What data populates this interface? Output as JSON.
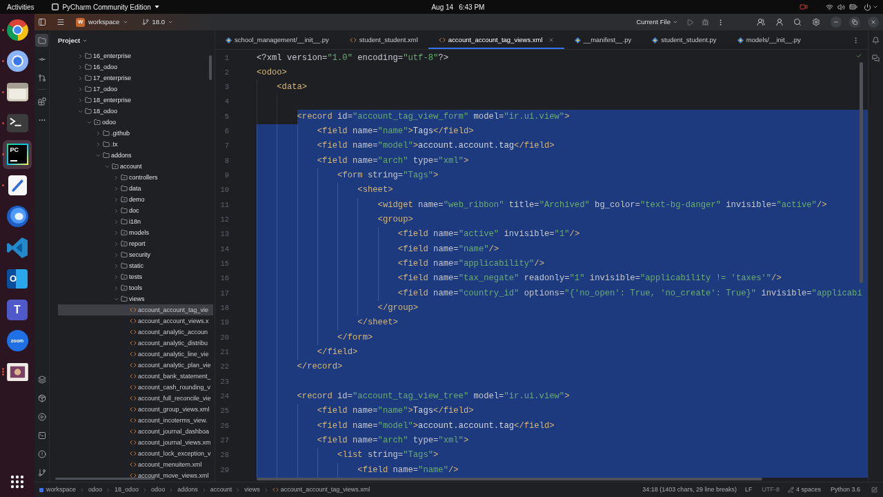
{
  "top_bar": {
    "activities": "Activities",
    "app_menu": "PyCharm Community Edition",
    "date": "Aug 14",
    "time": "6:43 PM"
  },
  "dock": {
    "apps": [
      {
        "kind": "browser",
        "running": true,
        "multiple_windows": false,
        "selected": false
      },
      {
        "kind": "browser_alt",
        "running": true,
        "multiple_windows": false,
        "selected": false
      },
      {
        "kind": "files",
        "running": true,
        "multiple_windows": false,
        "selected": false
      },
      {
        "kind": "terminal",
        "running": true,
        "multiple_windows": false,
        "selected": false
      },
      {
        "kind": "ide",
        "running": true,
        "multiple_windows": false,
        "selected": true,
        "logo_text": "PC"
      },
      {
        "kind": "editor",
        "running": true,
        "multiple_windows": false,
        "selected": false
      },
      {
        "kind": "mail_bird",
        "running": false,
        "selected": false
      },
      {
        "kind": "code_editor",
        "running": false,
        "selected": false
      },
      {
        "kind": "mail",
        "running": false,
        "selected": false,
        "logo_text": "O"
      },
      {
        "kind": "chat",
        "running": false,
        "selected": false,
        "logo_text": "T"
      },
      {
        "kind": "video",
        "running": false,
        "selected": false,
        "logo_text": "zoom"
      },
      {
        "kind": "image",
        "running": true,
        "multiple_windows": true,
        "selected": false
      }
    ]
  },
  "toolbar": {
    "project_badge": "W",
    "project": "workspace",
    "branch": "18.0",
    "run_configuration": "Current File"
  },
  "tool_strip": {
    "project_button": {
      "selected": true
    }
  },
  "project_panel": {
    "title": "Project",
    "tree": [
      {
        "kind": "folder",
        "label": "16_enterprise",
        "expanded": false,
        "selected": false
      },
      {
        "kind": "folder",
        "label": "16_odoo",
        "expanded": false,
        "selected": false
      },
      {
        "kind": "folder",
        "label": "17_enterprise",
        "expanded": false,
        "selected": false
      },
      {
        "kind": "folder",
        "label": "17_odoo",
        "expanded": false,
        "selected": false
      },
      {
        "kind": "folder",
        "label": "18_enterprise",
        "expanded": false,
        "selected": false
      },
      {
        "kind": "folder",
        "label": "18_odoo",
        "expanded": true,
        "selected": false,
        "children": [
          {
            "kind": "package",
            "label": "odoo",
            "expanded": true,
            "selected": false,
            "children": [
              {
                "kind": "folder",
                "label": ".github",
                "expanded": false,
                "selected": false
              },
              {
                "kind": "folder",
                "label": ".tx",
                "expanded": false,
                "selected": false
              },
              {
                "kind": "folder",
                "label": "addons",
                "expanded": true,
                "selected": false,
                "children": [
                  {
                    "kind": "package",
                    "label": "account",
                    "expanded": true,
                    "selected": false,
                    "children": [
                      {
                        "kind": "package",
                        "label": "controllers",
                        "expanded": false,
                        "selected": false
                      },
                      {
                        "kind": "folder",
                        "label": "data",
                        "expanded": false,
                        "selected": false
                      },
                      {
                        "kind": "package",
                        "label": "demo",
                        "expanded": false,
                        "selected": false
                      },
                      {
                        "kind": "folder",
                        "label": "doc",
                        "expanded": false,
                        "selected": false
                      },
                      {
                        "kind": "folder",
                        "label": "i18n",
                        "expanded": false,
                        "selected": false
                      },
                      {
                        "kind": "package",
                        "label": "models",
                        "expanded": false,
                        "selected": false
                      },
                      {
                        "kind": "package",
                        "label": "report",
                        "expanded": false,
                        "selected": false
                      },
                      {
                        "kind": "folder",
                        "label": "security",
                        "expanded": false,
                        "selected": false
                      },
                      {
                        "kind": "folder",
                        "label": "static",
                        "expanded": false,
                        "selected": false
                      },
                      {
                        "kind": "package",
                        "label": "tests",
                        "expanded": false,
                        "selected": false
                      },
                      {
                        "kind": "package",
                        "label": "tools",
                        "expanded": false,
                        "selected": false
                      },
                      {
                        "kind": "folder",
                        "label": "views",
                        "expanded": true,
                        "selected": false,
                        "children": [
                          {
                            "kind": "file",
                            "label": "account_account_tag_vie",
                            "selected": true
                          },
                          {
                            "kind": "file",
                            "label": "account_account_views.x",
                            "selected": false
                          },
                          {
                            "kind": "file",
                            "label": "account_analytic_accoun",
                            "selected": false
                          },
                          {
                            "kind": "file",
                            "label": "account_analytic_distribu",
                            "selected": false
                          },
                          {
                            "kind": "file",
                            "label": "account_analytic_line_vie",
                            "selected": false
                          },
                          {
                            "kind": "file",
                            "label": "account_analytic_plan_vie",
                            "selected": false
                          },
                          {
                            "kind": "file",
                            "label": "account_bank_statement_",
                            "selected": false
                          },
                          {
                            "kind": "file",
                            "label": "account_cash_rounding_v",
                            "selected": false
                          },
                          {
                            "kind": "file",
                            "label": "account_full_reconcile_vie",
                            "selected": false
                          },
                          {
                            "kind": "file",
                            "label": "account_group_views.xml",
                            "selected": false
                          },
                          {
                            "kind": "file",
                            "label": "account_incoterms_view.",
                            "selected": false
                          },
                          {
                            "kind": "file",
                            "label": "account_journal_dashboa",
                            "selected": false
                          },
                          {
                            "kind": "file",
                            "label": "account_journal_views.xm",
                            "selected": false
                          },
                          {
                            "kind": "file",
                            "label": "account_lock_exception_v",
                            "selected": false
                          },
                          {
                            "kind": "file",
                            "label": "account_menuitem.xml",
                            "selected": false
                          },
                          {
                            "kind": "file",
                            "label": "account_move_views.xml",
                            "selected": false
                          }
                        ]
                      }
                    ]
                  }
                ]
              }
            ]
          }
        ]
      }
    ]
  },
  "tabs": [
    {
      "kind": "python",
      "label": "school_management/__init__.py",
      "selected": false
    },
    {
      "kind": "xml",
      "label": "student_student.xml",
      "selected": false
    },
    {
      "kind": "xml",
      "label": "account_account_tag_views.xml",
      "selected": true
    },
    {
      "kind": "python",
      "label": "__manifest__.py",
      "selected": false
    },
    {
      "kind": "python",
      "label": "student_student.py",
      "selected": false
    },
    {
      "kind": "python",
      "label": "models/__init__.py",
      "selected": false
    }
  ],
  "editor": {
    "lines": [
      {
        "number": "1",
        "selected": false,
        "tokens": [
          {
            "kind": "prolog",
            "text": "<?xml"
          },
          {
            "kind": "attr",
            "text": " version="
          },
          {
            "kind": "value",
            "text": "\"1.0\""
          },
          {
            "kind": "attr",
            "text": " encoding="
          },
          {
            "kind": "value",
            "text": "\"utf-8\""
          },
          {
            "kind": "prolog",
            "text": "?>"
          }
        ]
      },
      {
        "number": "2",
        "selected": false,
        "tokens": [
          {
            "kind": "tag",
            "text": "<odoo>"
          }
        ],
        "children": [
          {
            "number": "3",
            "selected": false,
            "tokens": [
              {
                "kind": "tag",
                "text": "<data>"
              }
            ],
            "children": [
              {
                "number": "4",
                "selected": false
              },
              {
                "number": "5",
                "selected": true,
                "tokens": [
                  {
                    "kind": "tag",
                    "text": "<record"
                  },
                  {
                    "kind": "attr",
                    "text": " id="
                  },
                  {
                    "kind": "value",
                    "text": "\"account_tag_view_form\""
                  },
                  {
                    "kind": "attr",
                    "text": " model="
                  },
                  {
                    "kind": "value",
                    "text": "\"ir.ui.view\""
                  },
                  {
                    "kind": "tag",
                    "text": ">"
                  }
                ],
                "children": [
                  {
                    "number": "6",
                    "selected": true,
                    "tokens": [
                      {
                        "kind": "tag",
                        "text": "<field"
                      },
                      {
                        "kind": "attr",
                        "text": " name="
                      },
                      {
                        "kind": "value",
                        "text": "\"name\""
                      },
                      {
                        "kind": "tag",
                        "text": ">"
                      },
                      {
                        "kind": "text",
                        "text": "Tags"
                      },
                      {
                        "kind": "tag",
                        "text": "</field>"
                      }
                    ]
                  },
                  {
                    "number": "7",
                    "selected": true,
                    "tokens": [
                      {
                        "kind": "tag",
                        "text": "<field"
                      },
                      {
                        "kind": "attr",
                        "text": " name="
                      },
                      {
                        "kind": "value",
                        "text": "\"model\""
                      },
                      {
                        "kind": "tag",
                        "text": ">"
                      },
                      {
                        "kind": "text",
                        "text": "account.account.tag"
                      },
                      {
                        "kind": "tag",
                        "text": "</field>"
                      }
                    ]
                  },
                  {
                    "number": "8",
                    "selected": true,
                    "tokens": [
                      {
                        "kind": "tag",
                        "text": "<field"
                      },
                      {
                        "kind": "attr",
                        "text": " name="
                      },
                      {
                        "kind": "value",
                        "text": "\"arch\""
                      },
                      {
                        "kind": "attr",
                        "text": " type="
                      },
                      {
                        "kind": "value",
                        "text": "\"xml\""
                      },
                      {
                        "kind": "tag",
                        "text": ">"
                      }
                    ],
                    "children": [
                      {
                        "number": "9",
                        "selected": true,
                        "tokens": [
                          {
                            "kind": "tag",
                            "text": "<form"
                          },
                          {
                            "kind": "attr",
                            "text": " string="
                          },
                          {
                            "kind": "value",
                            "text": "\"Tags\""
                          },
                          {
                            "kind": "tag",
                            "text": ">"
                          }
                        ],
                        "children": [
                          {
                            "number": "10",
                            "selected": true,
                            "tokens": [
                              {
                                "kind": "tag",
                                "text": "<sheet>"
                              }
                            ],
                            "children": [
                              {
                                "number": "11",
                                "selected": true,
                                "tokens": [
                                  {
                                    "kind": "tag",
                                    "text": "<widget"
                                  },
                                  {
                                    "kind": "attr",
                                    "text": " name="
                                  },
                                  {
                                    "kind": "value",
                                    "text": "\"web_ribbon\""
                                  },
                                  {
                                    "kind": "attr",
                                    "text": " title="
                                  },
                                  {
                                    "kind": "value",
                                    "text": "\"Archived\""
                                  },
                                  {
                                    "kind": "attr",
                                    "text": " bg_color="
                                  },
                                  {
                                    "kind": "value",
                                    "text": "\"text-bg-danger\""
                                  },
                                  {
                                    "kind": "attr",
                                    "text": " invisible="
                                  },
                                  {
                                    "kind": "value",
                                    "text": "\"active\""
                                  },
                                  {
                                    "kind": "tag",
                                    "text": "/>"
                                  }
                                ]
                              },
                              {
                                "number": "12",
                                "selected": true,
                                "tokens": [
                                  {
                                    "kind": "tag",
                                    "text": "<group>"
                                  }
                                ],
                                "children": [
                                  {
                                    "number": "13",
                                    "selected": true,
                                    "tokens": [
                                      {
                                        "kind": "tag",
                                        "text": "<field"
                                      },
                                      {
                                        "kind": "attr",
                                        "text": " name="
                                      },
                                      {
                                        "kind": "value",
                                        "text": "\"active\""
                                      },
                                      {
                                        "kind": "attr",
                                        "text": " invisible="
                                      },
                                      {
                                        "kind": "value",
                                        "text": "\"1\""
                                      },
                                      {
                                        "kind": "tag",
                                        "text": "/>"
                                      }
                                    ]
                                  },
                                  {
                                    "number": "14",
                                    "selected": true,
                                    "tokens": [
                                      {
                                        "kind": "tag",
                                        "text": "<field"
                                      },
                                      {
                                        "kind": "attr",
                                        "text": " name="
                                      },
                                      {
                                        "kind": "value",
                                        "text": "\"name\""
                                      },
                                      {
                                        "kind": "tag",
                                        "text": "/>"
                                      }
                                    ]
                                  },
                                  {
                                    "number": "15",
                                    "selected": true,
                                    "tokens": [
                                      {
                                        "kind": "tag",
                                        "text": "<field"
                                      },
                                      {
                                        "kind": "attr",
                                        "text": " name="
                                      },
                                      {
                                        "kind": "value",
                                        "text": "\"applicability\""
                                      },
                                      {
                                        "kind": "tag",
                                        "text": "/>"
                                      }
                                    ]
                                  },
                                  {
                                    "number": "16",
                                    "selected": true,
                                    "tokens": [
                                      {
                                        "kind": "tag",
                                        "text": "<field"
                                      },
                                      {
                                        "kind": "attr",
                                        "text": " name="
                                      },
                                      {
                                        "kind": "value",
                                        "text": "\"tax_negate\""
                                      },
                                      {
                                        "kind": "attr",
                                        "text": " readonly="
                                      },
                                      {
                                        "kind": "value",
                                        "text": "\"1\""
                                      },
                                      {
                                        "kind": "attr",
                                        "text": " invisible="
                                      },
                                      {
                                        "kind": "value",
                                        "text": "\"applicability != 'taxes'\""
                                      },
                                      {
                                        "kind": "tag",
                                        "text": "/>"
                                      }
                                    ]
                                  },
                                  {
                                    "number": "17",
                                    "selected": true,
                                    "tokens": [
                                      {
                                        "kind": "tag",
                                        "text": "<field"
                                      },
                                      {
                                        "kind": "attr",
                                        "text": " name="
                                      },
                                      {
                                        "kind": "value",
                                        "text": "\"country_id\""
                                      },
                                      {
                                        "kind": "attr",
                                        "text": " options="
                                      },
                                      {
                                        "kind": "value",
                                        "text": "\"{'no_open': True, 'no_create': True}\""
                                      },
                                      {
                                        "kind": "attr",
                                        "text": " invisible="
                                      },
                                      {
                                        "kind": "value",
                                        "text": "\"applicabi"
                                      }
                                    ]
                                  }
                                ]
                              },
                              {
                                "number": "18",
                                "selected": true,
                                "tokens": [
                                  {
                                    "kind": "tag",
                                    "text": "</group>"
                                  }
                                ]
                              }
                            ]
                          },
                          {
                            "number": "19",
                            "selected": true,
                            "tokens": [
                              {
                                "kind": "tag",
                                "text": "</sheet>"
                              }
                            ]
                          }
                        ]
                      },
                      {
                        "number": "20",
                        "selected": true,
                        "tokens": [
                          {
                            "kind": "tag",
                            "text": "</form>"
                          }
                        ]
                      }
                    ]
                  },
                  {
                    "number": "21",
                    "selected": true,
                    "tokens": [
                      {
                        "kind": "tag",
                        "text": "</field>"
                      }
                    ]
                  }
                ]
              },
              {
                "number": "22",
                "selected": true,
                "tokens": [
                  {
                    "kind": "tag",
                    "text": "</record>"
                  }
                ]
              },
              {
                "number": "23",
                "selected": true
              },
              {
                "number": "24",
                "selected": true,
                "tokens": [
                  {
                    "kind": "tag",
                    "text": "<record"
                  },
                  {
                    "kind": "attr",
                    "text": " id="
                  },
                  {
                    "kind": "value",
                    "text": "\"account_tag_view_tree\""
                  },
                  {
                    "kind": "attr",
                    "text": " model="
                  },
                  {
                    "kind": "value",
                    "text": "\"ir.ui.view\""
                  },
                  {
                    "kind": "tag",
                    "text": ">"
                  }
                ],
                "children": [
                  {
                    "number": "25",
                    "selected": true,
                    "tokens": [
                      {
                        "kind": "tag",
                        "text": "<field"
                      },
                      {
                        "kind": "attr",
                        "text": " name="
                      },
                      {
                        "kind": "value",
                        "text": "\"name\""
                      },
                      {
                        "kind": "tag",
                        "text": ">"
                      },
                      {
                        "kind": "text",
                        "text": "Tags"
                      },
                      {
                        "kind": "tag",
                        "text": "</field>"
                      }
                    ]
                  },
                  {
                    "number": "26",
                    "selected": true,
                    "tokens": [
                      {
                        "kind": "tag",
                        "text": "<field"
                      },
                      {
                        "kind": "attr",
                        "text": " name="
                      },
                      {
                        "kind": "value",
                        "text": "\"model\""
                      },
                      {
                        "kind": "tag",
                        "text": ">"
                      },
                      {
                        "kind": "text",
                        "text": "account.account.tag"
                      },
                      {
                        "kind": "tag",
                        "text": "</field>"
                      }
                    ]
                  },
                  {
                    "number": "27",
                    "selected": true,
                    "tokens": [
                      {
                        "kind": "tag",
                        "text": "<field"
                      },
                      {
                        "kind": "attr",
                        "text": " name="
                      },
                      {
                        "kind": "value",
                        "text": "\"arch\""
                      },
                      {
                        "kind": "attr",
                        "text": " type="
                      },
                      {
                        "kind": "value",
                        "text": "\"xml\""
                      },
                      {
                        "kind": "tag",
                        "text": ">"
                      }
                    ],
                    "children": [
                      {
                        "number": "28",
                        "selected": true,
                        "tokens": [
                          {
                            "kind": "tag",
                            "text": "<list"
                          },
                          {
                            "kind": "attr",
                            "text": " string="
                          },
                          {
                            "kind": "value",
                            "text": "\"Tags\""
                          },
                          {
                            "kind": "tag",
                            "text": ">"
                          }
                        ],
                        "children": [
                          {
                            "number": "29",
                            "selected": true,
                            "tokens": [
                              {
                                "kind": "tag",
                                "text": "<field"
                              },
                              {
                                "kind": "attr",
                                "text": " name="
                              },
                              {
                                "kind": "value",
                                "text": "\"name\""
                              },
                              {
                                "kind": "tag",
                                "text": "/>"
                              }
                            ]
                          }
                        ]
                      }
                    ]
                  }
                ]
              }
            ]
          }
        ]
      }
    ]
  },
  "status_bar": {
    "breadcrumbs": [
      "workspace",
      "odoo",
      "18_odoo",
      "odoo",
      "addons",
      "account",
      "views",
      "account_account_tag_views.xml"
    ],
    "caret_position": "34:18 (1403 chars, 29 line breaks)",
    "line_separator": "LF",
    "encoding": "UTF-8",
    "indentation": "4 spaces",
    "interpreter": "Python 3.6"
  }
}
